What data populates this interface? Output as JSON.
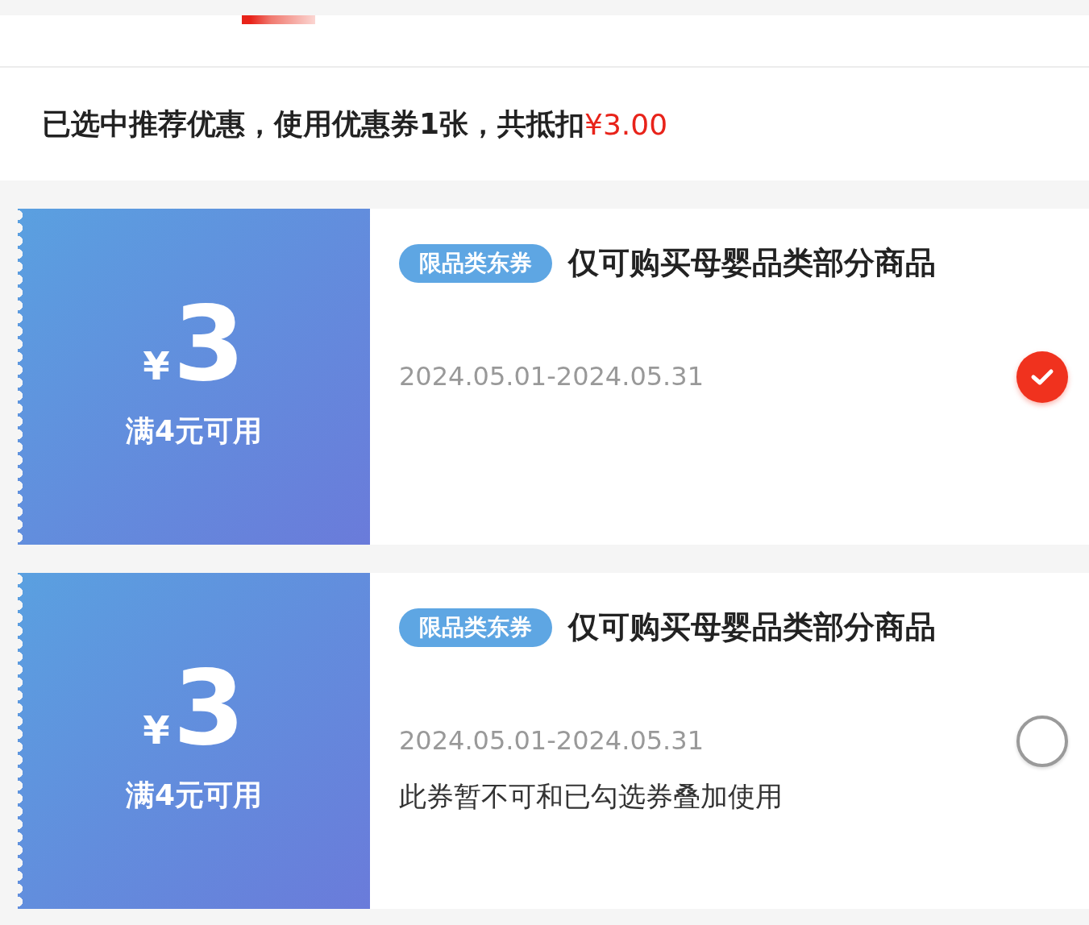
{
  "summary": {
    "text": "已选中推荐优惠，使用优惠券1张，共抵扣",
    "total": "¥3.00"
  },
  "coupons": [
    {
      "currency": "¥",
      "amount": "3",
      "condition": "满4元可用",
      "tag": "限品类东券",
      "title": "仅可购买母婴品类部分商品",
      "validity": "2024.05.01-2024.05.31",
      "selected": true
    },
    {
      "currency": "¥",
      "amount": "3",
      "condition": "满4元可用",
      "tag": "限品类东券",
      "title": "仅可购买母婴品类部分商品",
      "validity": "2024.05.01-2024.05.31",
      "note": "此券暂不可和已勾选券叠加使用",
      "selected": false
    }
  ]
}
